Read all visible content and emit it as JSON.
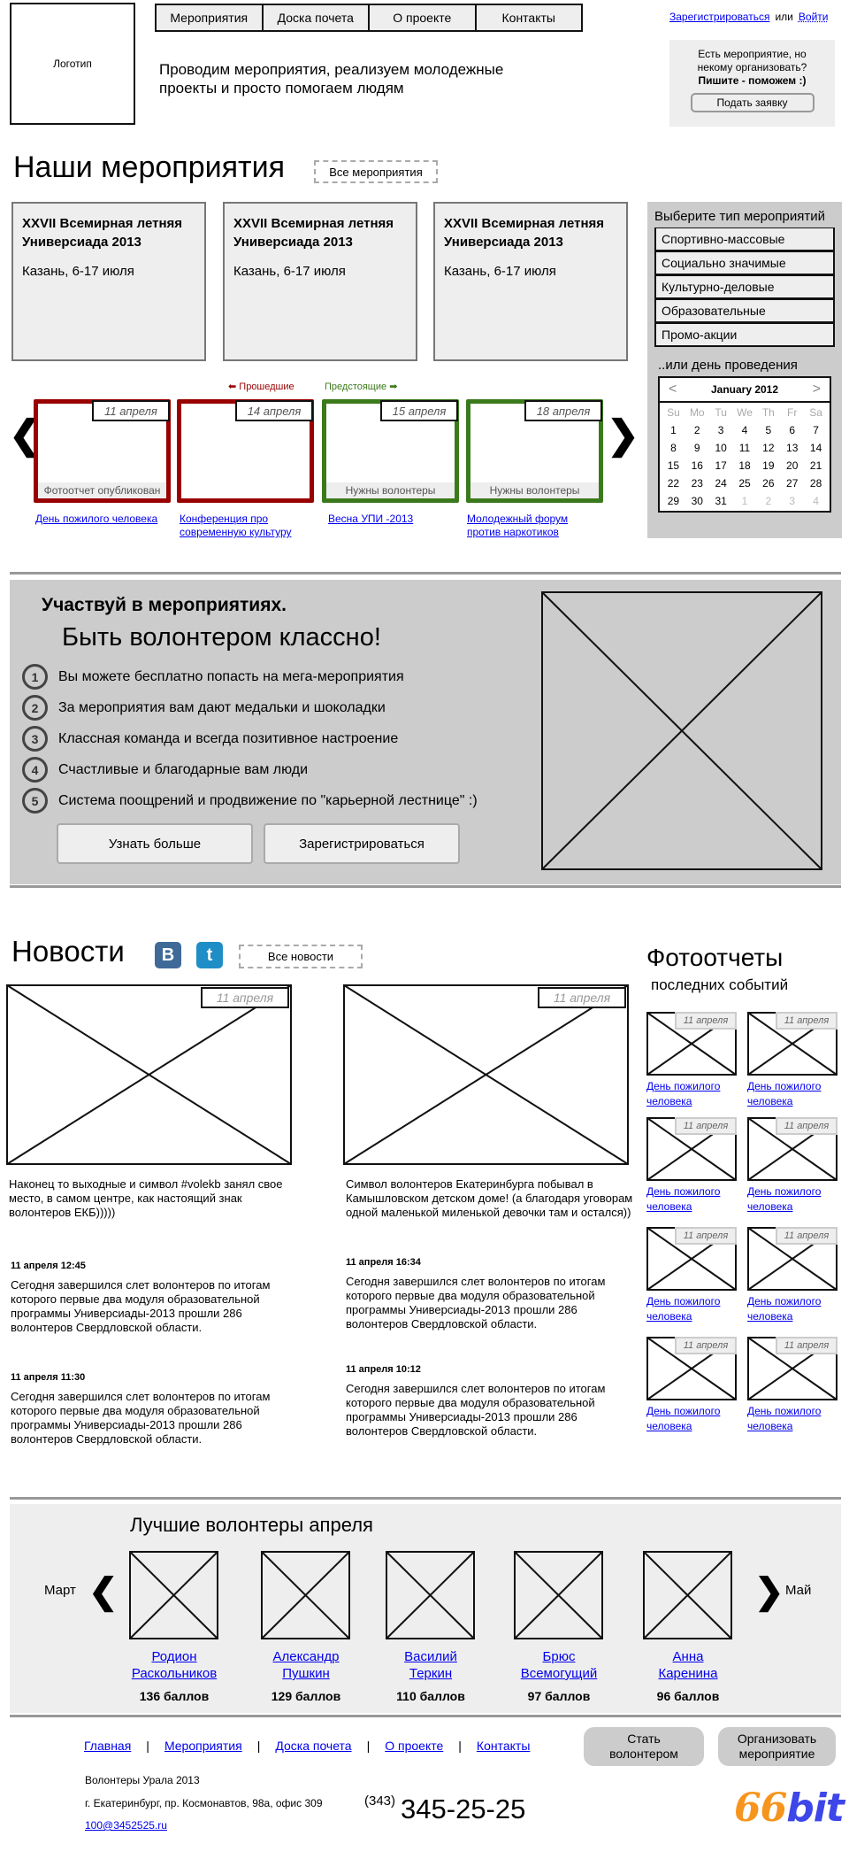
{
  "header": {
    "logo_label": "Логотип",
    "nav": [
      "Мероприятия",
      "Доска почета",
      "О проекте",
      "Контакты"
    ],
    "tagline": "Проводим мероприятия, реализуем молодежные проекты и просто помогаем людям",
    "auth": {
      "register": "Зарегистрироваться",
      "or": "или",
      "login": "Войти"
    },
    "offer": {
      "line1": "Есть мероприятие, но некому организовать?",
      "line2": "Пишите - поможем :)",
      "button": "Подать заявку"
    }
  },
  "events": {
    "title": "Наши мероприятия",
    "all_link": "Все мероприятия",
    "cards": [
      {
        "title": "XXVII Всемирная летняя Универсиада 2013",
        "place": "Казань, 6-17 июля"
      },
      {
        "title": "XXVII Всемирная летняя Универсиада 2013",
        "place": "Казань, 6-17 июля"
      },
      {
        "title": "XXVII Всемирная летняя Универсиада 2013",
        "place": "Казань, 6-17 июля"
      }
    ],
    "past_label": "Прошедшие",
    "future_label": "Предстоящие",
    "carousel": [
      {
        "date": "11 апреля",
        "status": "Фотоотчет опубликован",
        "caption": "День пожилого человека",
        "state": "past"
      },
      {
        "date": "14 апреля",
        "status": "",
        "caption": "Конференция про современную культуру",
        "state": "past"
      },
      {
        "date": "15 апреля",
        "status": "Нужны волонтеры",
        "caption": "Весна УПИ -2013",
        "state": "future"
      },
      {
        "date": "18 апреля",
        "status": "Нужны волонтеры",
        "caption": "Молодежный форум против наркотиков",
        "state": "future"
      }
    ],
    "colors": {
      "past": "#990000",
      "future": "#3b7a1c"
    }
  },
  "filter": {
    "title": "Выберите тип мероприятий",
    "types": [
      "Спортивно-массовые",
      "Социально значимые",
      "Культурно-деловые",
      "Образовательные",
      "Промо-акции"
    ],
    "date_title": "..или день проведения",
    "calendar": {
      "month": "January 2012",
      "prev": "<",
      "next": ">",
      "dow": [
        "Su",
        "Mo",
        "Tu",
        "We",
        "Th",
        "Fr",
        "Sa"
      ],
      "days": [
        "1",
        "2",
        "3",
        "4",
        "5",
        "6",
        "7",
        "8",
        "9",
        "10",
        "11",
        "12",
        "13",
        "14",
        "15",
        "16",
        "17",
        "18",
        "19",
        "20",
        "21",
        "22",
        "23",
        "24",
        "25",
        "26",
        "27",
        "28",
        "29",
        "30",
        "31"
      ],
      "trailing": [
        "1",
        "2",
        "3",
        "4"
      ]
    }
  },
  "banner": {
    "title1": "Участвуй в мероприятиях.",
    "title2": "Быть волонтером классно!",
    "benefits": [
      {
        "n": "1",
        "text": "Вы можете бесплатно попасть на мега-мероприятия"
      },
      {
        "n": "2",
        "text": "За мероприятия вам дают медальки и шоколадки"
      },
      {
        "n": "3",
        "text": "Классная команда и всегда позитивное настроение"
      },
      {
        "n": "4",
        "text": "Счастливые и благодарные вам люди"
      },
      {
        "n": "5",
        "text": "Система поощрений и продвижение по \"карьерной лестнице\" :)"
      }
    ],
    "btn_more": "Узнать больше",
    "btn_register": "Зарегистрироваться"
  },
  "news": {
    "title": "Новости",
    "vk": "B",
    "twitter": "t",
    "all_link": "Все новости",
    "columns": [
      {
        "date": "11 апреля",
        "lead": "Наконец то выходные и символ #volekb занял свое место, в самом центре, как настоящий знак волонтеров ЕКБ)))))",
        "items": [
          {
            "ts": "11 апреля 12:45",
            "text": "Сегодня завершился слет волонтеров по итогам которого первые два модуля образовательной программы Универсиады-2013 прошли 286 волонтеров Свердловской области."
          },
          {
            "ts": "11 апреля 11:30",
            "text": "Сегодня завершился слет волонтеров по итогам которого первые два модуля образовательной программы Универсиады-2013 прошли 286 волонтеров Свердловской области."
          }
        ]
      },
      {
        "date": "11 апреля",
        "lead": "Символ волонтеров Екатеринбурга побывал в Камышловском детском доме! (а благодаря уговорам одной маленькой миленькой девочки там и остался))",
        "items": [
          {
            "ts": "11 апреля 16:34",
            "text": "Сегодня завершился слет волонтеров по итогам которого первые два модуля образовательной программы Универсиады-2013 прошли 286 волонтеров Свердловской области."
          },
          {
            "ts": "11 апреля 10:12",
            "text": "Сегодня завершился слет волонтеров по итогам которого первые два модуля образовательной программы Универсиады-2013 прошли 286 волонтеров Свердловской области."
          }
        ]
      }
    ]
  },
  "photo_reports": {
    "title": "Фотоотчеты",
    "subtitle": "последних событий",
    "items": [
      {
        "date": "11 апреля",
        "caption": "День пожилого человека"
      },
      {
        "date": "11 апреля",
        "caption": "День пожилого человека"
      },
      {
        "date": "11 апреля",
        "caption": "День пожилого человека"
      },
      {
        "date": "11 апреля",
        "caption": "День пожилого человека"
      },
      {
        "date": "11 апреля",
        "caption": "День пожилого человека"
      },
      {
        "date": "11 апреля",
        "caption": "День пожилого человека"
      },
      {
        "date": "11 апреля",
        "caption": "День пожилого человека"
      },
      {
        "date": "11 апреля",
        "caption": "День пожилого человека"
      }
    ]
  },
  "best": {
    "title": "Лучшие волонтеры апреля",
    "prev_month": "Март",
    "next_month": "Май",
    "volunteers": [
      {
        "first": "Родион",
        "last": "Раскольников",
        "points": "136 баллов"
      },
      {
        "first": "Александр",
        "last": "Пушкин",
        "points": "129 баллов"
      },
      {
        "first": "Василий",
        "last": "Теркин",
        "points": "110 баллов"
      },
      {
        "first": "Брюс",
        "last": "Всемогущий",
        "points": "97 баллов"
      },
      {
        "first": "Анна",
        "last": "Каренина",
        "points": "96 баллов"
      }
    ]
  },
  "footer": {
    "links": [
      "Главная",
      "Мероприятия",
      "Доска почета",
      "О проекте",
      "Контакты"
    ],
    "separator": "|",
    "btn_volunteer": "Стать волонтером",
    "btn_organize": "Организовать мероприятие",
    "org_name": "Волонтеры Урала 2013",
    "address": "г. Екатеринбург, пр. Космонавтов, 98а, офис 309",
    "email": "100@3452525.ru",
    "phone_code": "(343)",
    "phone": "345-25-25",
    "brand_a": "66",
    "brand_b": "bit"
  }
}
